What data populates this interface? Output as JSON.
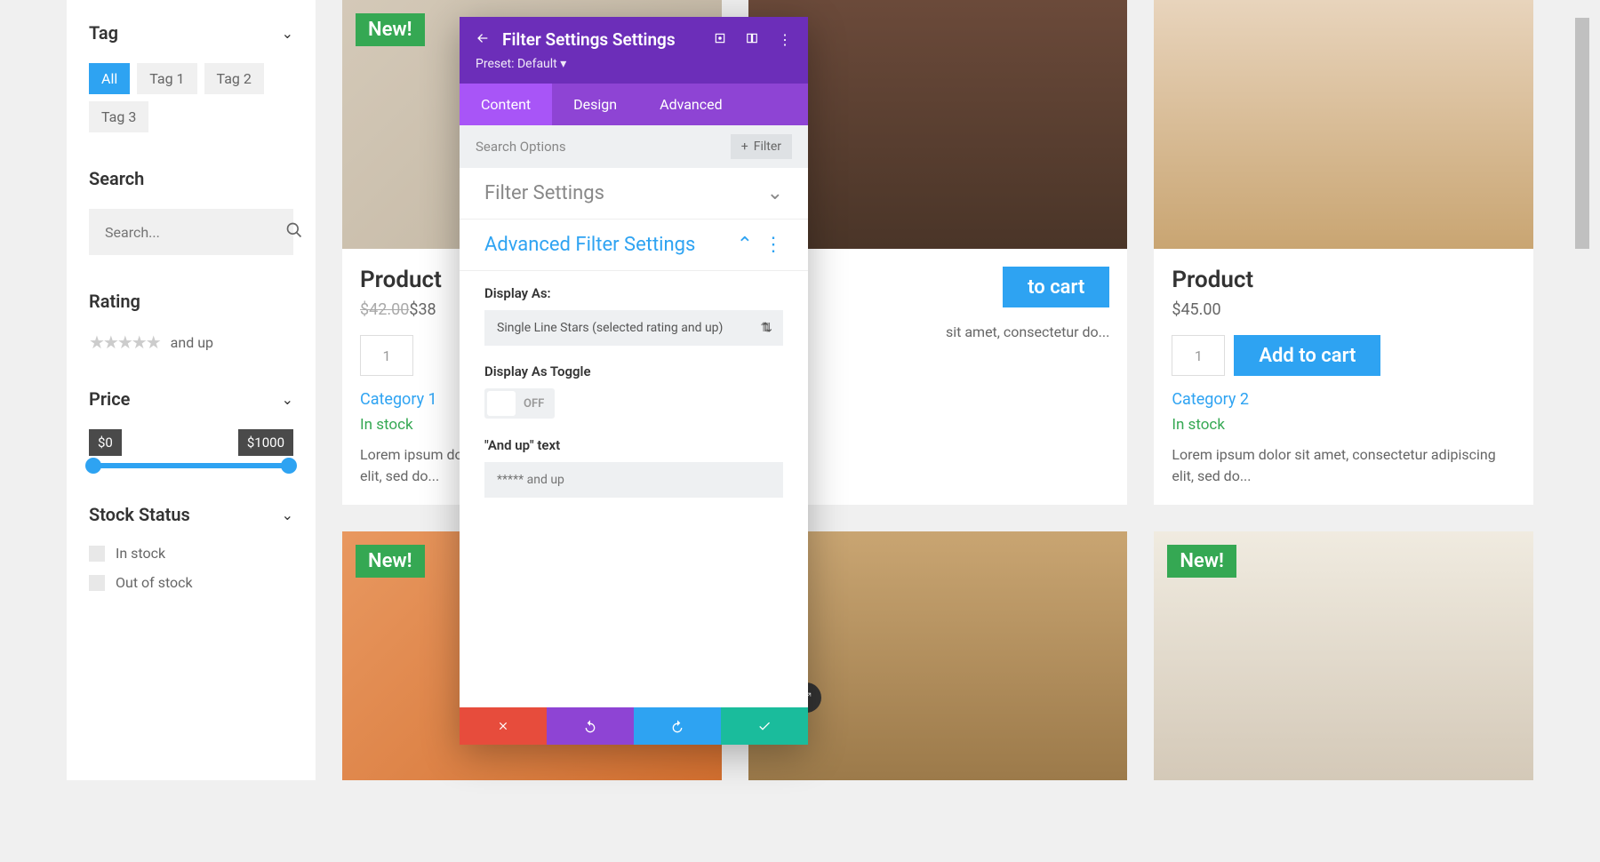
{
  "sidebar": {
    "tag": {
      "title": "Tag",
      "items": [
        "All",
        "Tag 1",
        "Tag 2",
        "Tag 3"
      ]
    },
    "search": {
      "title": "Search",
      "placeholder": "Search..."
    },
    "rating": {
      "title": "Rating",
      "text": "and up"
    },
    "price": {
      "title": "Price",
      "min": "$0",
      "max": "$1000"
    },
    "stock": {
      "title": "Stock Status",
      "items": [
        "In stock",
        "Out of stock"
      ]
    }
  },
  "products": [
    {
      "badge": "New!",
      "title": "Product",
      "old_price": "$42.00",
      "price": "$38",
      "qty": "1",
      "category": "Category 1",
      "stock": "In stock",
      "desc": "Lorem ipsum dolor sit amet, consectetur adipiscing elit, sed do..."
    },
    {
      "badge": "",
      "title": "",
      "price": "",
      "qty": "",
      "add": "to cart",
      "category": "",
      "stock": "",
      "desc": "sit amet, consectetur do..."
    },
    {
      "badge": "",
      "title": "Product",
      "price": "$45.00",
      "qty": "1",
      "add": "Add to cart",
      "category": "Category 2",
      "stock": "In stock",
      "desc": "Lorem ipsum dolor sit amet, consectetur adipiscing elit, sed do..."
    },
    {
      "badge": "New!"
    },
    {
      "badge": ""
    },
    {
      "badge": "New!"
    }
  ],
  "panel": {
    "title": "Filter Settings Settings",
    "preset": "Preset: Default ▾",
    "tabs": [
      "Content",
      "Design",
      "Advanced"
    ],
    "search": "Search Options",
    "filter_btn": "Filter",
    "section1": "Filter Settings",
    "section2": "Advanced Filter Settings",
    "display_as_label": "Display As:",
    "display_as_value": "Single Line Stars (selected rating and up)",
    "toggle_label": "Display As Toggle",
    "toggle_state": "OFF",
    "andup_label": "\"And up\" text",
    "andup_placeholder": "***** and up"
  },
  "add_to_cart": "Add to cart"
}
